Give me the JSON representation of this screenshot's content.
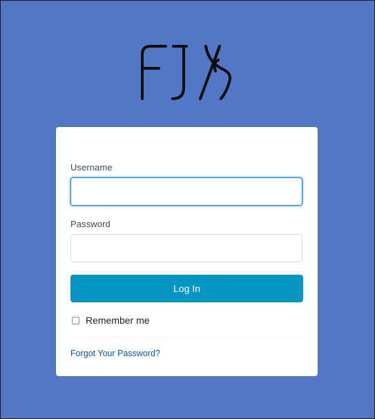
{
  "brand": {
    "logo_text": "FJX",
    "background_color": "#5376c6",
    "accent_color": "#0597c3"
  },
  "form": {
    "username_label": "Username",
    "username_value": "",
    "password_label": "Password",
    "password_value": "",
    "login_label": "Log In",
    "remember_label": "Remember me",
    "remember_checked": false,
    "forgot_label": "Forgot Your Password?"
  }
}
